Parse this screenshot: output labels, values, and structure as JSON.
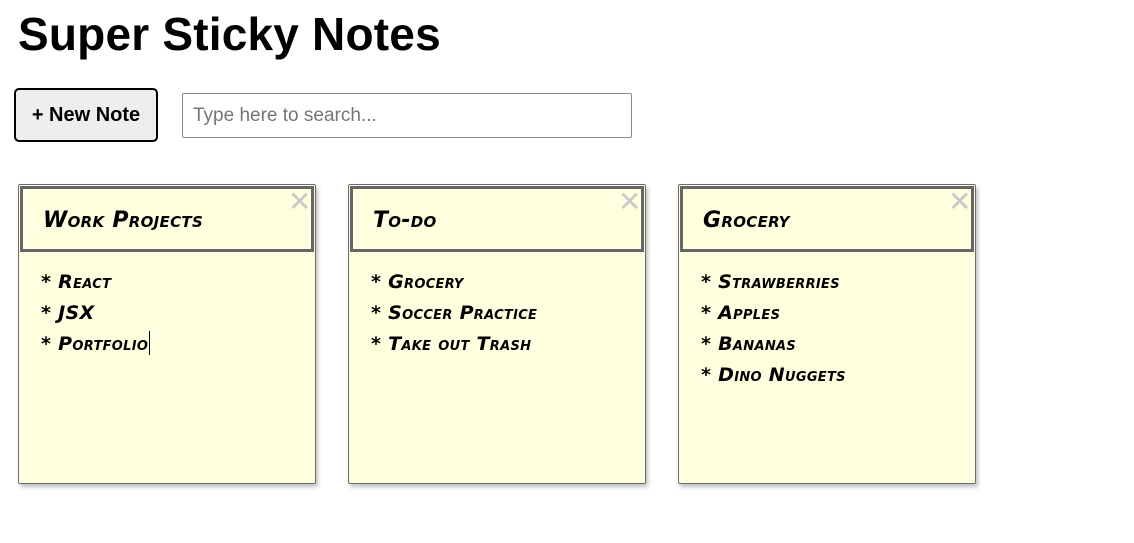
{
  "app": {
    "title": "Super Sticky Notes"
  },
  "toolbar": {
    "new_note_label": "+ New Note",
    "search_placeholder": "Type here to search...",
    "search_value": ""
  },
  "notes": [
    {
      "title": "Work Projects",
      "close_glyph": "✕",
      "lines": [
        "* React",
        "* JSX",
        "* Portfolio"
      ]
    },
    {
      "title": "To-do",
      "close_glyph": "✕",
      "lines": [
        "* Grocery",
        "* Soccer Practice",
        "* Take out Trash"
      ]
    },
    {
      "title": "Grocery",
      "close_glyph": "✕",
      "lines": [
        "* Strawberries",
        "* Apples",
        "* Bananas",
        "* Dino Nuggets"
      ]
    }
  ],
  "colors": {
    "note_background": "#fffedf",
    "note_border": "#666666",
    "close_icon": "#c9c9c9",
    "button_background": "#eeeeee"
  }
}
